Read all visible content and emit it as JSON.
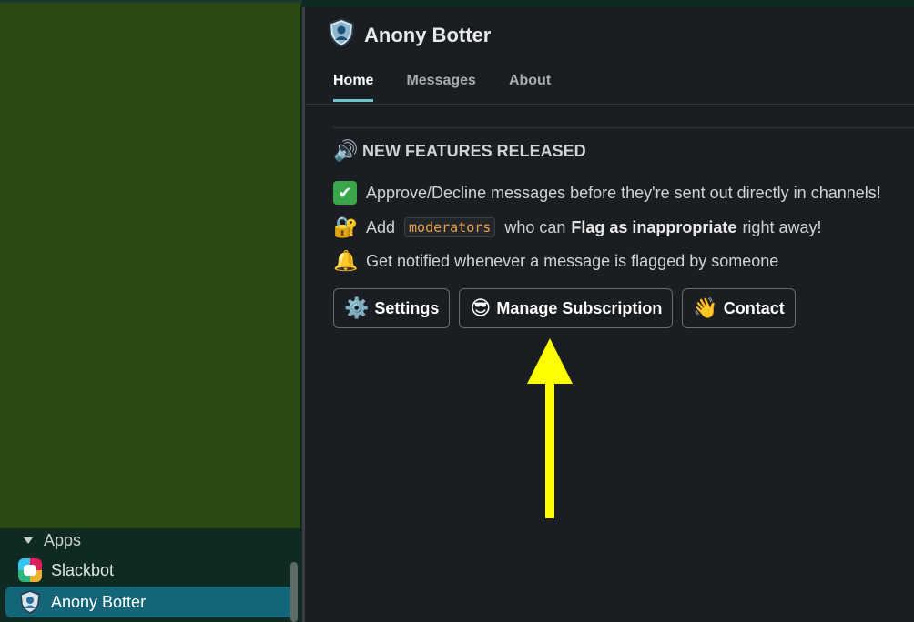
{
  "sidebar": {
    "section_label": "Apps",
    "items": [
      {
        "label": "Slackbot"
      },
      {
        "label": "Anony Botter"
      }
    ]
  },
  "app": {
    "title": "Anony Botter",
    "tabs": [
      {
        "label": "Home"
      },
      {
        "label": "Messages"
      },
      {
        "label": "About"
      }
    ],
    "headline_emoji": "🔊",
    "headline": "NEW FEATURES RELEASED",
    "features": [
      {
        "icon": "✔",
        "text": "Approve/Decline messages before they're sent out directly in channels!"
      },
      {
        "icon": "🔐",
        "pre": "Add",
        "code": "moderators",
        "mid": "who can",
        "bold": "Flag as inappropriate",
        "post": "right away!"
      },
      {
        "icon": "🔔",
        "text": "Get notified whenever a message is flagged by someone"
      }
    ],
    "buttons": [
      {
        "icon": "⚙️",
        "label": "Settings"
      },
      {
        "icon": "😎",
        "label": "Manage Subscription"
      },
      {
        "icon": "👋",
        "label": "Contact"
      }
    ]
  },
  "colors": {
    "sidebar_active": "#136577",
    "sidebar_green": "#2b4a11",
    "tab_underline": "#6ec4c8",
    "arrow": "#ffff00"
  }
}
